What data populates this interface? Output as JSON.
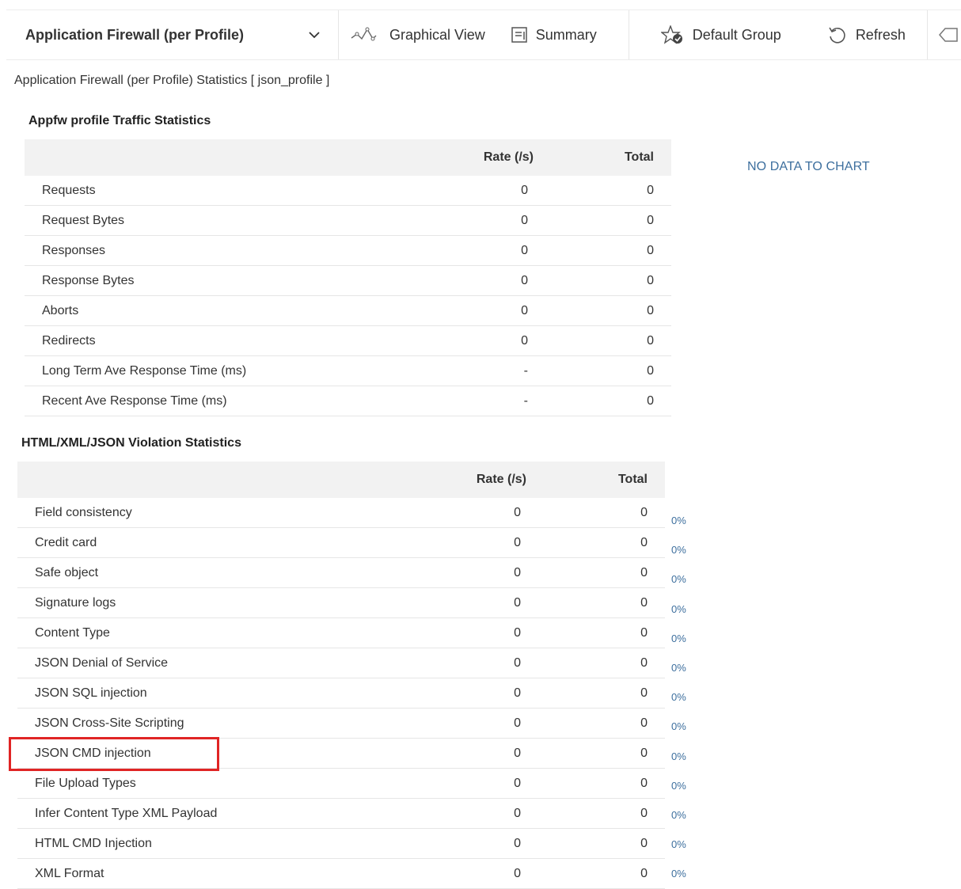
{
  "toolbar": {
    "selector_label": "Application Firewall (per Profile)",
    "graphical_view": "Graphical View",
    "summary": "Summary",
    "default_group": "Default Group",
    "refresh": "Refresh"
  },
  "page_title": "Application Firewall (per Profile) Statistics [ json_profile ]",
  "traffic": {
    "title": "Appfw profile Traffic Statistics",
    "headers": [
      "Rate (/s)",
      "Total"
    ],
    "rows": [
      {
        "name": "Requests",
        "rate": "0",
        "total": "0"
      },
      {
        "name": "Request Bytes",
        "rate": "0",
        "total": "0"
      },
      {
        "name": "Responses",
        "rate": "0",
        "total": "0"
      },
      {
        "name": "Response Bytes",
        "rate": "0",
        "total": "0"
      },
      {
        "name": "Aborts",
        "rate": "0",
        "total": "0"
      },
      {
        "name": "Redirects",
        "rate": "0",
        "total": "0"
      },
      {
        "name": "Long Term Ave Response Time (ms)",
        "rate": "-",
        "total": "0"
      },
      {
        "name": "Recent Ave Response Time (ms)",
        "rate": "-",
        "total": "0"
      }
    ]
  },
  "no_data": "NO DATA TO  CHART",
  "violations": {
    "title": "HTML/XML/JSON Violation Statistics",
    "headers": [
      "Rate (/s)",
      "Total"
    ],
    "rows": [
      {
        "name": "Field consistency",
        "rate": "0",
        "total": "0",
        "pct": "0%"
      },
      {
        "name": "Credit card",
        "rate": "0",
        "total": "0",
        "pct": "0%"
      },
      {
        "name": "Safe object",
        "rate": "0",
        "total": "0",
        "pct": "0%"
      },
      {
        "name": "Signature logs",
        "rate": "0",
        "total": "0",
        "pct": "0%"
      },
      {
        "name": "Content Type",
        "rate": "0",
        "total": "0",
        "pct": "0%"
      },
      {
        "name": "JSON Denial of Service",
        "rate": "0",
        "total": "0",
        "pct": "0%"
      },
      {
        "name": "JSON SQL injection",
        "rate": "0",
        "total": "0",
        "pct": "0%"
      },
      {
        "name": "JSON Cross-Site Scripting",
        "rate": "0",
        "total": "0",
        "pct": "0%"
      },
      {
        "name": "JSON CMD injection",
        "rate": "0",
        "total": "0",
        "pct": "0%"
      },
      {
        "name": "File Upload Types",
        "rate": "0",
        "total": "0",
        "pct": "0%"
      },
      {
        "name": "Infer Content Type XML Payload",
        "rate": "0",
        "total": "0",
        "pct": "0%"
      },
      {
        "name": "HTML CMD Injection",
        "rate": "0",
        "total": "0",
        "pct": "0%"
      },
      {
        "name": "XML Format",
        "rate": "0",
        "total": "0",
        "pct": "0%"
      }
    ]
  },
  "colors": {
    "highlight": "#e02424",
    "link": "#3d6f9e",
    "header_bg": "#f2f2f2"
  }
}
